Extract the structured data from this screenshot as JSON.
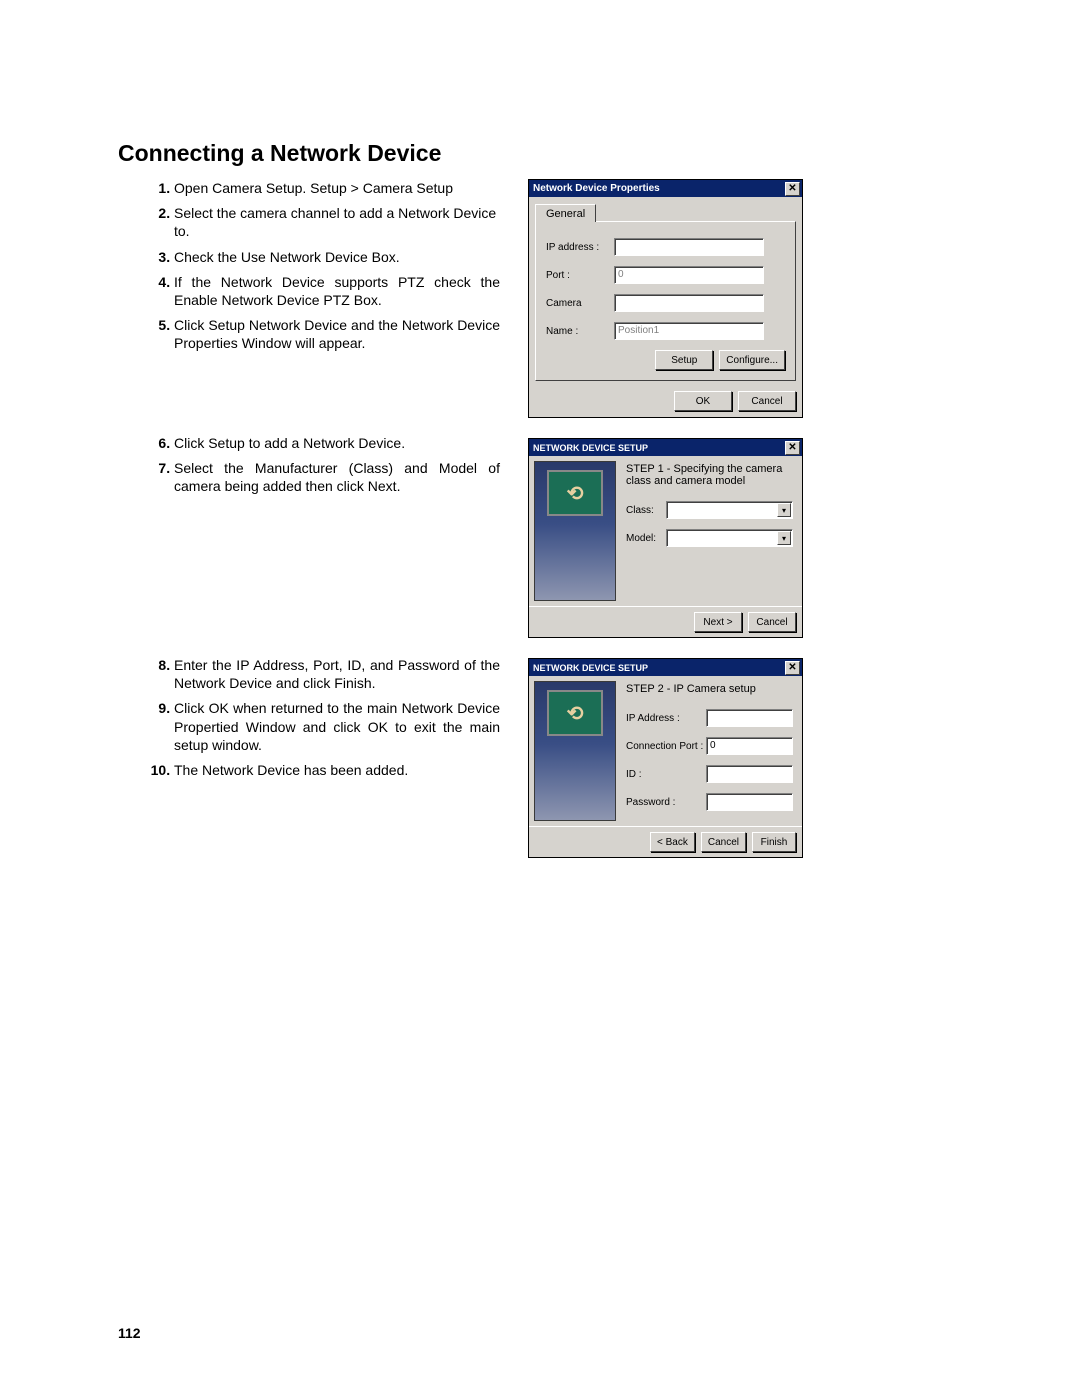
{
  "heading": "Connecting a Network Device",
  "page_number": "112",
  "steps": [
    {
      "n": "1.",
      "text": "Open Camera Setup.  Setup > Camera Setup"
    },
    {
      "n": "2.",
      "text": "Select the camera channel to add a Network Device to."
    },
    {
      "n": "3.",
      "text": "Check the Use Network Device Box."
    },
    {
      "n": "4.",
      "text": "If the Network Device supports PTZ check the Enable Network Device PTZ Box.",
      "justify": true
    },
    {
      "n": "5.",
      "text": "Click Setup Network Device and the Network Device Properties Window will appear.",
      "justify": true
    },
    {
      "n": "6.",
      "text": "Click Setup to add a Network Device."
    },
    {
      "n": "7.",
      "text": "Select the Manufacturer (Class) and Model of camera being added then click Next.",
      "justify": true
    },
    {
      "n": "8.",
      "text": "Enter the IP Address, Port, ID, and Password of the Network Device and click Finish.",
      "justify": true
    },
    {
      "n": "9.",
      "text": "Click OK when returned to the main Network Device Propertied Window and click OK to exit the main setup window.",
      "justify": true
    },
    {
      "n": "10.",
      "text": "The Network Device has been added."
    }
  ],
  "dialog1": {
    "title": "Network Device Properties",
    "tab": "General",
    "fields": {
      "ip_label": "IP address :",
      "ip_value": "",
      "port_label": "Port :",
      "port_value": "0",
      "camera_label": "Camera",
      "camera_value": "",
      "name_label": "Name :",
      "name_value": "Position1"
    },
    "buttons": {
      "setup": "Setup",
      "configure": "Configure...",
      "ok": "OK",
      "cancel": "Cancel"
    }
  },
  "dialog2": {
    "title": "NETWORK DEVICE SETUP",
    "step": "STEP 1 -  Specifying the camera class and camera model",
    "fields": {
      "class_label": "Class:",
      "model_label": "Model:"
    },
    "buttons": {
      "next": "Next >",
      "cancel": "Cancel"
    }
  },
  "dialog3": {
    "title": "NETWORK DEVICE SETUP",
    "step": "STEP 2 -  IP Camera setup",
    "fields": {
      "ip_label": "IP Address :",
      "ip_value": "",
      "port_label": "Connection Port :",
      "port_value": "0",
      "id_label": "ID :",
      "id_value": "",
      "pw_label": "Password :",
      "pw_value": ""
    },
    "buttons": {
      "back": "< Back",
      "cancel": "Cancel",
      "finish": "Finish"
    }
  }
}
